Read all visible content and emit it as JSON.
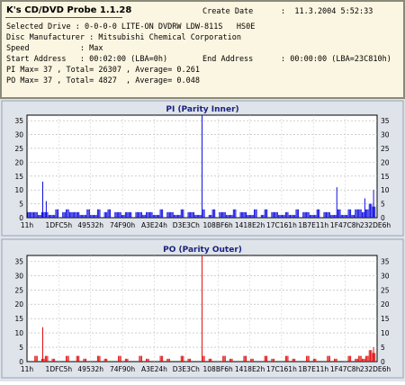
{
  "app": {
    "title": "K's CD/DVD Probe 1.1.28"
  },
  "info": {
    "create_date_label": "Create Date",
    "create_date_value": ":  11.3.2004 5:52:33",
    "selected_drive": "Selected Drive : 0-0-0-0 LITE-ON DVDRW LDW-811S   HS0E",
    "disc_manufacturer": "Disc Manufacturer : Mitsubishi Chemical Corporation",
    "speed": "Speed           : Max",
    "start_address": "Start Address   : 00:02:00 (LBA=0h)",
    "end_address": "End Address      : 00:00:00 (LBA=23C810h)",
    "pi_stats": "PI Max= 37 , Total= 26307 , Average= 0.261",
    "po_stats": "PO Max= 37 , Total= 4827  , Average= 0.048"
  },
  "colors": {
    "pi": "#1010e0",
    "po": "#e01010",
    "chart_bg": "#ffffff",
    "panel_bg": "#dfe3ea"
  },
  "chart_data": [
    {
      "type": "bar",
      "title": "PI (Parity Inner)",
      "xlabel": "",
      "ylabel": "",
      "ylim": [
        0,
        37
      ],
      "yticks": [
        0,
        5,
        10,
        15,
        20,
        25,
        30,
        35
      ],
      "x_ticks": [
        "11h",
        "1DFC5h",
        "49532h",
        "74F90h",
        "A3E24h",
        "D3E3Ch",
        "108BF6h",
        "1418E2h",
        "17C161h",
        "1B7E11h",
        "1F47C8h",
        "232DE6h"
      ],
      "grid": true,
      "baseline": [
        3,
        2,
        1,
        2,
        2,
        1,
        2,
        1,
        2,
        1,
        2,
        2,
        3,
        2,
        1,
        2,
        1,
        2,
        2,
        1,
        2,
        1,
        2,
        2,
        1,
        2,
        1,
        2,
        2,
        1,
        1,
        2,
        1,
        2,
        2,
        1,
        2,
        1,
        2,
        1,
        2,
        1,
        2,
        1,
        2,
        1,
        2,
        1,
        2,
        1,
        2,
        1,
        1,
        2,
        1,
        2,
        1,
        2,
        1,
        2,
        1,
        2,
        1,
        2,
        1,
        2,
        1,
        1,
        2,
        1,
        2,
        1,
        2,
        1,
        1,
        2,
        1,
        2,
        1,
        2,
        1,
        2,
        1,
        2,
        1,
        2,
        1,
        2,
        1,
        2,
        2,
        1,
        2,
        2,
        3,
        2,
        3,
        3,
        4,
        5
      ],
      "spikes": [
        {
          "x": 0.045,
          "y": 13
        },
        {
          "x": 0.055,
          "y": 6
        },
        {
          "x": 0.5,
          "y": 37
        },
        {
          "x": 0.885,
          "y": 11
        },
        {
          "x": 0.965,
          "y": 7
        },
        {
          "x": 0.99,
          "y": 10
        }
      ]
    },
    {
      "type": "bar",
      "title": "PO (Parity Outer)",
      "xlabel": "",
      "ylabel": "",
      "ylim": [
        0,
        37
      ],
      "yticks": [
        0,
        5,
        10,
        15,
        20,
        25,
        30,
        35
      ],
      "x_ticks": [
        "11h",
        "1DFC5h",
        "49532h",
        "74F90h",
        "A3E24h",
        "D3E3Ch",
        "108BF6h",
        "1418E2h",
        "17C161h",
        "1B7E11h",
        "1F47C8h",
        "232DE6h"
      ],
      "grid": true,
      "baseline": [
        1,
        0,
        1,
        0,
        1,
        1,
        0,
        1,
        0,
        1,
        0,
        1,
        1,
        0,
        1,
        0,
        1,
        0,
        1,
        0,
        1,
        0,
        1,
        0,
        1,
        0,
        1,
        0,
        1,
        0,
        1,
        0,
        1,
        0,
        1,
        0,
        1,
        0,
        1,
        0,
        1,
        0,
        1,
        0,
        1,
        0,
        1,
        0,
        1,
        0,
        1,
        0,
        1,
        0,
        1,
        0,
        1,
        0,
        1,
        0,
        1,
        0,
        1,
        0,
        1,
        0,
        1,
        0,
        1,
        0,
        1,
        0,
        1,
        0,
        1,
        0,
        1,
        0,
        1,
        0,
        1,
        0,
        1,
        0,
        1,
        0,
        1,
        0,
        1,
        0,
        1,
        0,
        1,
        0,
        1,
        1,
        2,
        2,
        3,
        4
      ],
      "spikes": [
        {
          "x": 0.045,
          "y": 12
        },
        {
          "x": 0.5,
          "y": 37
        },
        {
          "x": 0.99,
          "y": 5
        }
      ]
    }
  ]
}
